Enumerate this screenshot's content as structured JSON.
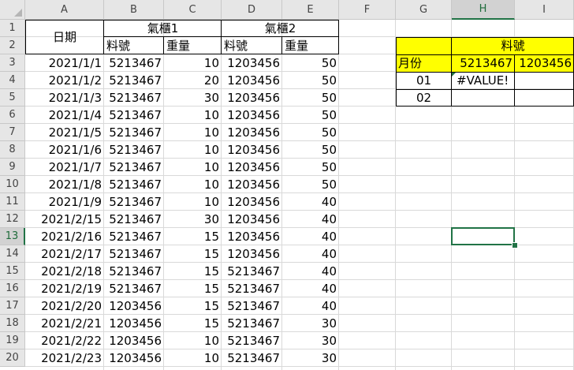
{
  "columns": [
    "A",
    "B",
    "C",
    "D",
    "E",
    "F",
    "G",
    "H",
    "I"
  ],
  "rows": [
    "1",
    "2",
    "3",
    "4",
    "5",
    "6",
    "7",
    "8",
    "9",
    "10",
    "11",
    "12",
    "13",
    "14",
    "15",
    "16",
    "17",
    "18",
    "19",
    "20"
  ],
  "selected_cell": {
    "column": "H",
    "row": "13"
  },
  "header": {
    "date_label": "日期",
    "cabinet1": "氣櫃1",
    "cabinet2": "氣櫃2",
    "part_no": "料號",
    "weight": "重量"
  },
  "data_rows": [
    {
      "date": "2021/1/1",
      "part1": "5213467",
      "w1": "10",
      "part2": "1203456",
      "w2": "50"
    },
    {
      "date": "2021/1/2",
      "part1": "5213467",
      "w1": "20",
      "part2": "1203456",
      "w2": "50"
    },
    {
      "date": "2021/1/3",
      "part1": "5213467",
      "w1": "30",
      "part2": "1203456",
      "w2": "50"
    },
    {
      "date": "2021/1/4",
      "part1": "5213467",
      "w1": "10",
      "part2": "1203456",
      "w2": "50"
    },
    {
      "date": "2021/1/5",
      "part1": "5213467",
      "w1": "10",
      "part2": "1203456",
      "w2": "50"
    },
    {
      "date": "2021/1/6",
      "part1": "5213467",
      "w1": "10",
      "part2": "1203456",
      "w2": "50"
    },
    {
      "date": "2021/1/7",
      "part1": "5213467",
      "w1": "10",
      "part2": "1203456",
      "w2": "50"
    },
    {
      "date": "2021/1/8",
      "part1": "5213467",
      "w1": "10",
      "part2": "1203456",
      "w2": "50"
    },
    {
      "date": "2021/1/9",
      "part1": "5213467",
      "w1": "10",
      "part2": "1203456",
      "w2": "40"
    },
    {
      "date": "2021/2/15",
      "part1": "5213467",
      "w1": "30",
      "part2": "1203456",
      "w2": "40"
    },
    {
      "date": "2021/2/16",
      "part1": "5213467",
      "w1": "15",
      "part2": "1203456",
      "w2": "40"
    },
    {
      "date": "2021/2/17",
      "part1": "5213467",
      "w1": "15",
      "part2": "1203456",
      "w2": "40"
    },
    {
      "date": "2021/2/18",
      "part1": "5213467",
      "w1": "15",
      "part2": "5213467",
      "w2": "40"
    },
    {
      "date": "2021/2/19",
      "part1": "5213467",
      "w1": "15",
      "part2": "5213467",
      "w2": "40"
    },
    {
      "date": "2021/2/20",
      "part1": "1203456",
      "w1": "15",
      "part2": "5213467",
      "w2": "40"
    },
    {
      "date": "2021/2/21",
      "part1": "1203456",
      "w1": "15",
      "part2": "5213467",
      "w2": "30"
    },
    {
      "date": "2021/2/22",
      "part1": "1203456",
      "w1": "10",
      "part2": "5213467",
      "w2": "30"
    },
    {
      "date": "2021/2/23",
      "part1": "1203456",
      "w1": "10",
      "part2": "5213467",
      "w2": "30"
    }
  ],
  "summary": {
    "part_header": "料號",
    "month_label": "月份",
    "part_a": "5213467",
    "part_b": "1203456",
    "month1": "01",
    "month2": "02",
    "h4_value": "#VALUE!"
  },
  "colors": {
    "highlight": "#ffff00",
    "selection": "#217346",
    "header_bg": "#e6e6e6"
  }
}
